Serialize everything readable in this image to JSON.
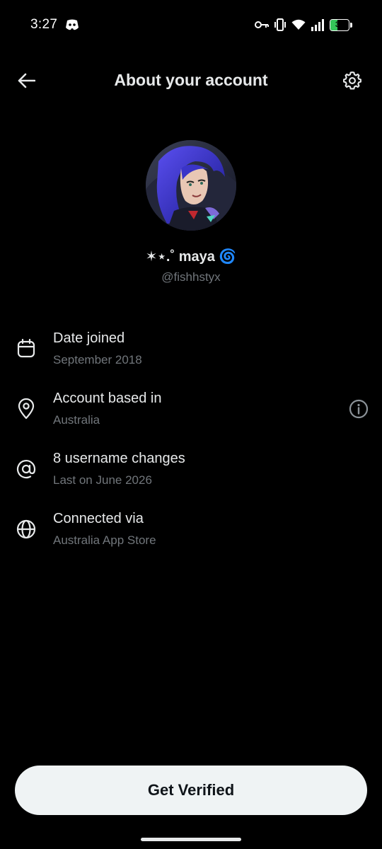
{
  "status_bar": {
    "time": "3:27",
    "battery_level": "37",
    "battery_percent": 37,
    "icons": [
      "discord-icon",
      "vpn-key-icon",
      "vibrate-icon",
      "wifi-icon",
      "signal-icon",
      "battery-icon"
    ]
  },
  "header": {
    "title": "About your account",
    "back_icon": "arrow-left-icon",
    "settings_icon": "gear-icon"
  },
  "profile": {
    "display_name": "✶⋆.˚ maya 🌀",
    "handle": "@fishhstyx"
  },
  "info_items": [
    {
      "icon": "calendar-icon",
      "label": "Date joined",
      "value": "September 2018"
    },
    {
      "icon": "location-pin-icon",
      "label": "Account based in",
      "value": "Australia",
      "action_icon": "info-icon"
    },
    {
      "icon": "at-sign-icon",
      "label": "8 username changes",
      "value": "Last on June 2026"
    },
    {
      "icon": "globe-icon",
      "label": "Connected via",
      "value": "Australia App Store"
    }
  ],
  "footer": {
    "verify_label": "Get Verified"
  },
  "colors": {
    "background": "#000000",
    "primary_text": "#e7e9ea",
    "secondary_text": "#71767b",
    "button_background": "#eff3f4",
    "button_text": "#0f1419",
    "battery_green": "#34c759"
  }
}
